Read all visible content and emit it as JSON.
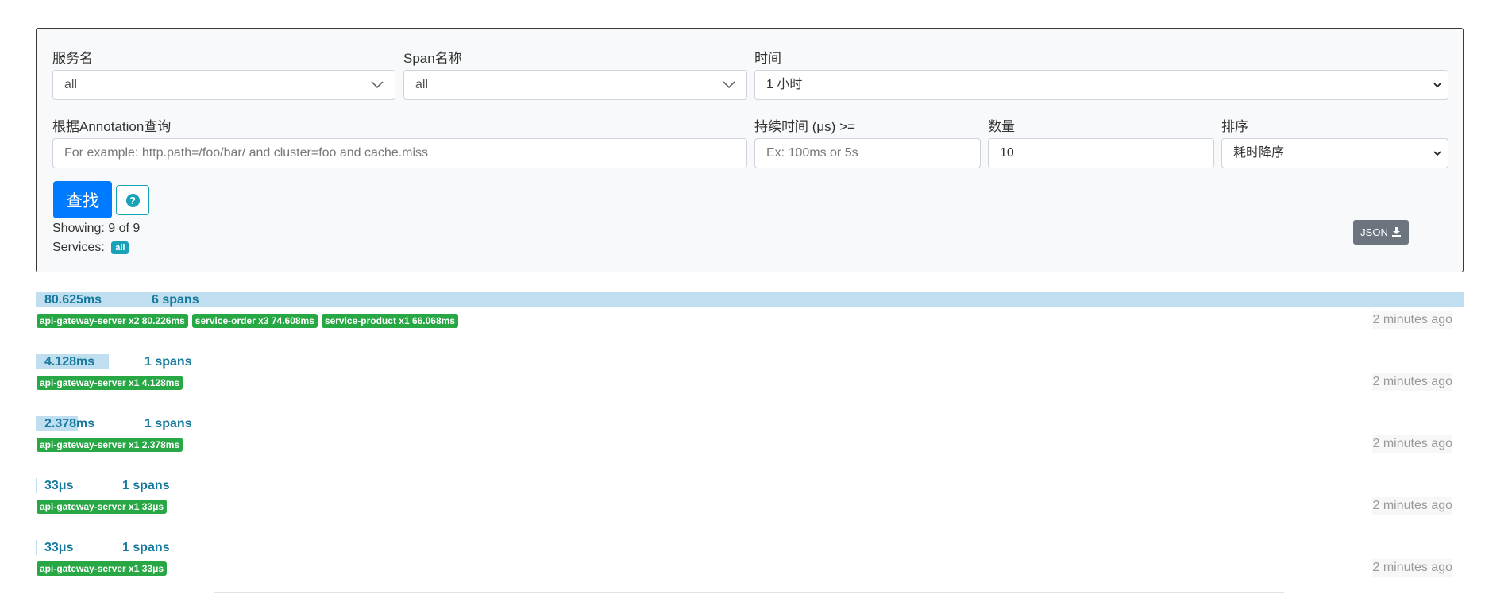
{
  "search": {
    "service_label": "服务名",
    "service_value": "all",
    "span_label": "Span名称",
    "span_value": "all",
    "time_label": "时间",
    "time_value": "1 小时",
    "annotation_label": "根据Annotation查询",
    "annotation_placeholder": "For example: http.path=/foo/bar/ and cluster=foo and cache.miss",
    "duration_label": "持续时间 (μs) >=",
    "duration_placeholder": "Ex: 100ms or 5s",
    "limit_label": "数量",
    "limit_value": "10",
    "sort_label": "排序",
    "sort_value": "耗时降序",
    "search_button": "查找",
    "showing_text": "Showing: 9 of 9",
    "services_label": "Services:",
    "services_badge": "all",
    "json_button": "JSON"
  },
  "traces": [
    {
      "duration": "80.625ms",
      "spans": "6 spans",
      "bar_fraction": 1.0,
      "tags": [
        "api-gateway-server x2 80.226ms",
        "service-order x3 74.608ms",
        "service-product x1 66.068ms"
      ],
      "time": "2 minutes ago"
    },
    {
      "duration": "4.128ms",
      "spans": "1 spans",
      "bar_fraction": 0.0512,
      "tags": [
        "api-gateway-server x1 4.128ms"
      ],
      "time": "2 minutes ago"
    },
    {
      "duration": "2.378ms",
      "spans": "1 spans",
      "bar_fraction": 0.0295,
      "tags": [
        "api-gateway-server x1 2.378ms"
      ],
      "time": "2 minutes ago"
    },
    {
      "duration": "33μs",
      "spans": "1 spans",
      "bar_fraction": 0.0004,
      "tags": [
        "api-gateway-server x1 33μs"
      ],
      "time": "2 minutes ago"
    },
    {
      "duration": "33μs",
      "spans": "1 spans",
      "bar_fraction": 0.0004,
      "tags": [
        "api-gateway-server x1 33μs"
      ],
      "time": "2 minutes ago"
    }
  ]
}
